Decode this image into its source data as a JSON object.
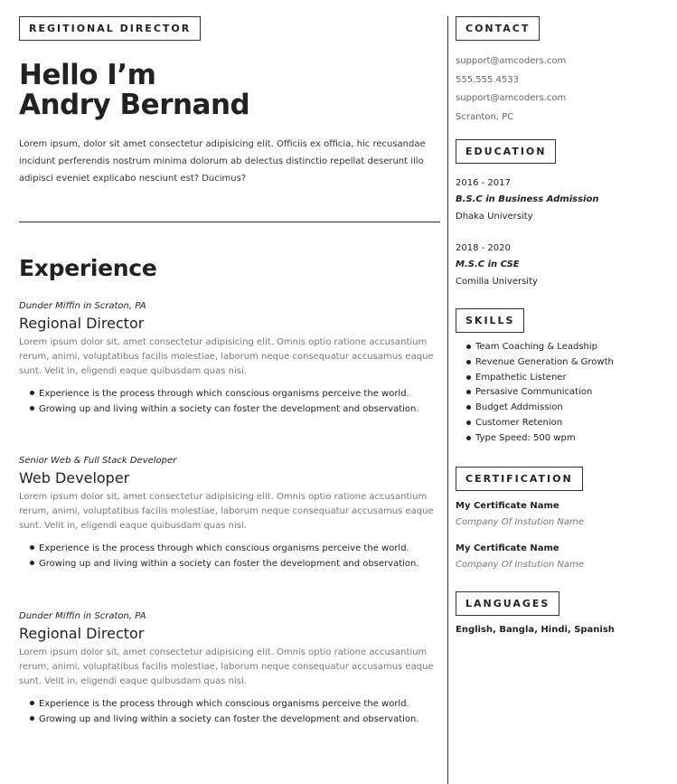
{
  "header": {
    "tag": "REGITIONAL DIRECTOR",
    "hello_line1": "Hello I’m",
    "hello_line2": "Andry Bernand",
    "intro": "Lorem ipsum, dolor sit amet consectetur adipisicing elit. Officiis ex officia, hic recusandae incidunt perferendis nostrum minima dolorum ab delectus distinctio repellat deserunt illo adipisci eveniet explicabo nesciunt est? Ducimus?"
  },
  "experience": {
    "title": "Experience",
    "jobs": [
      {
        "company": "Dunder Miffin in Scraton, PA",
        "role": "Regional Director",
        "desc": "Lorem ipsum dolor sit, amet consectetur adipisicing elit. Omnis optio ratione accusantium rerum, animi, voluptatibus facilis molestiae, laborum neque consequatur accusamus eaque sunt. Velit in, eligendi eaque quibusdam quas nisi.",
        "bullets": [
          "Experience is the process through which conscious organisms perceive the world.",
          "Growing up and living within a society can foster the development and observation."
        ]
      },
      {
        "company": "Senior Web & Full Stack Developer",
        "role": "Web Developer",
        "desc": "Lorem ipsum dolor sit, amet consectetur adipisicing elit. Omnis optio ratione accusantium rerum, animi, voluptatibus facilis molestiae, laborum neque consequatur accusamus eaque sunt. Velit in, eligendi eaque quibusdam quas nisi.",
        "bullets": [
          "Experience is the process through which conscious organisms perceive the world.",
          "Growing up and living within a society can foster the development and observation."
        ]
      },
      {
        "company": "Dunder Miffin in Scraton, PA",
        "role": "Regional Director",
        "desc": "Lorem ipsum dolor sit, amet consectetur adipisicing elit. Omnis optio ratione accusantium rerum, animi, voluptatibus facilis molestiae, laborum neque consequatur accusamus eaque sunt. Velit in, eligendi eaque quibusdam quas nisi.",
        "bullets": [
          "Experience is the process through which conscious organisms perceive the world.",
          "Growing up and living within a society can foster the development and observation."
        ]
      }
    ]
  },
  "contact": {
    "title": "CONTACT",
    "email1": "support@amcoders.com",
    "phone": "555.555.4533",
    "email2": "support@amcoders.com",
    "location": "Scranton, PC"
  },
  "education": {
    "title": "EDUCATION",
    "items": [
      {
        "years": "2016 - 2017",
        "degree": "B.S.C in Business Admission",
        "school": "Dhaka University"
      },
      {
        "years": "2018 - 2020",
        "degree": "M.S.C in CSE",
        "school": "Comilla University"
      }
    ]
  },
  "skills": {
    "title": "SKILLS",
    "items": [
      "Team Coaching & Leadship",
      "Revenue Generation & Growth",
      "Empathetic Listener",
      "Persasive Communication",
      "Budget Addmission",
      "Customer Retenion",
      "Type Speed: 500 wpm"
    ]
  },
  "certification": {
    "title": "CERTIFICATION",
    "items": [
      {
        "name": "My Certificate Name",
        "company": "Company Of Instution Name"
      },
      {
        "name": "My Certificate Name",
        "company": "Company Of Instution Name"
      }
    ]
  },
  "languages": {
    "title": "LANGUAGES",
    "list": "English, Bangla, Hindi, Spanish"
  }
}
